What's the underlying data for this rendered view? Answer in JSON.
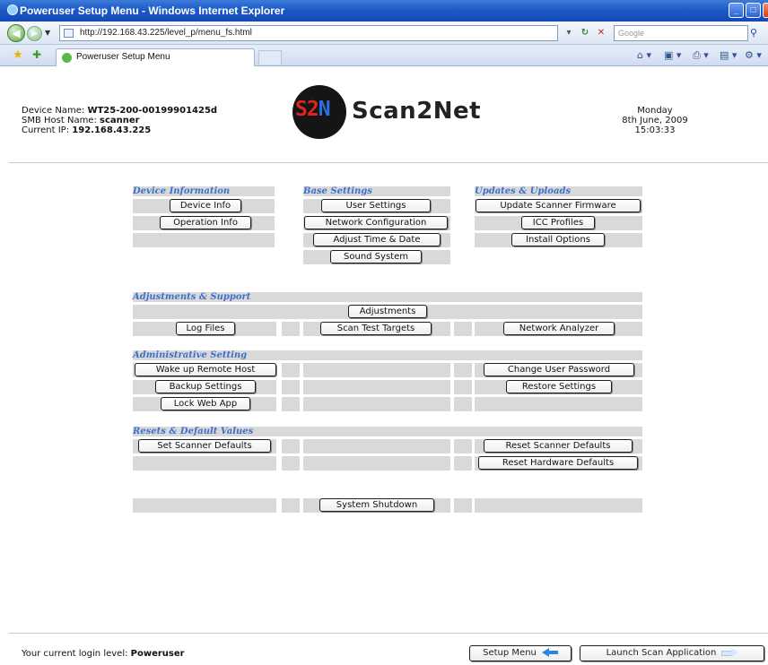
{
  "window": {
    "title": "Poweruser Setup Menu - Windows Internet Explorer",
    "url": "http://192.168.43.225/level_p/menu_fs.html",
    "search_placeholder": "Google",
    "tab_title": "Poweruser Setup Menu"
  },
  "header": {
    "device_name_label": "Device Name:",
    "device_name": "WT25-200-00199901425d",
    "smb_label": "SMB Host Name:",
    "smb_host": "scanner",
    "ip_label": "Current IP:",
    "ip": "192.168.43.225",
    "logo_mark_a": "S2",
    "logo_mark_b": "N",
    "logo_text": "Scan2Net",
    "day": "Monday",
    "date": "8th June, 2009",
    "time": "15:03:33"
  },
  "sections": {
    "device_information": "Device Information",
    "base_settings": "Base Settings",
    "updates_uploads": "Updates & Uploads",
    "adjustments_support": "Adjustments & Support",
    "administrative_setting": "Administrative Setting",
    "resets_defaults": "Resets & Default Values"
  },
  "buttons": {
    "device_info": "Device Info",
    "operation_info": "Operation Info",
    "user_settings": "User Settings",
    "network_configuration": "Network Configuration",
    "adjust_time_date": "Adjust Time & Date",
    "sound_system": "Sound System",
    "update_firmware": "Update Scanner Firmware",
    "icc_profiles": "ICC Profiles",
    "install_options": "Install Options",
    "adjustments": "Adjustments",
    "log_files": "Log Files",
    "scan_test_targets": "Scan Test Targets",
    "network_analyzer": "Network Analyzer",
    "wake_remote_host": "Wake up Remote Host",
    "change_user_password": "Change User Password",
    "backup_settings": "Backup Settings",
    "restore_settings": "Restore Settings",
    "lock_web_app": "Lock Web App",
    "set_scanner_defaults": "Set Scanner Defaults",
    "reset_scanner_defaults": "Reset Scanner Defaults",
    "reset_hardware_defaults": "Reset Hardware Defaults",
    "system_shutdown": "System Shutdown"
  },
  "footer": {
    "login_label": "Your current login level:",
    "login_level": "Poweruser",
    "setup_menu": "Setup Menu",
    "launch_scan": "Launch Scan Application"
  }
}
